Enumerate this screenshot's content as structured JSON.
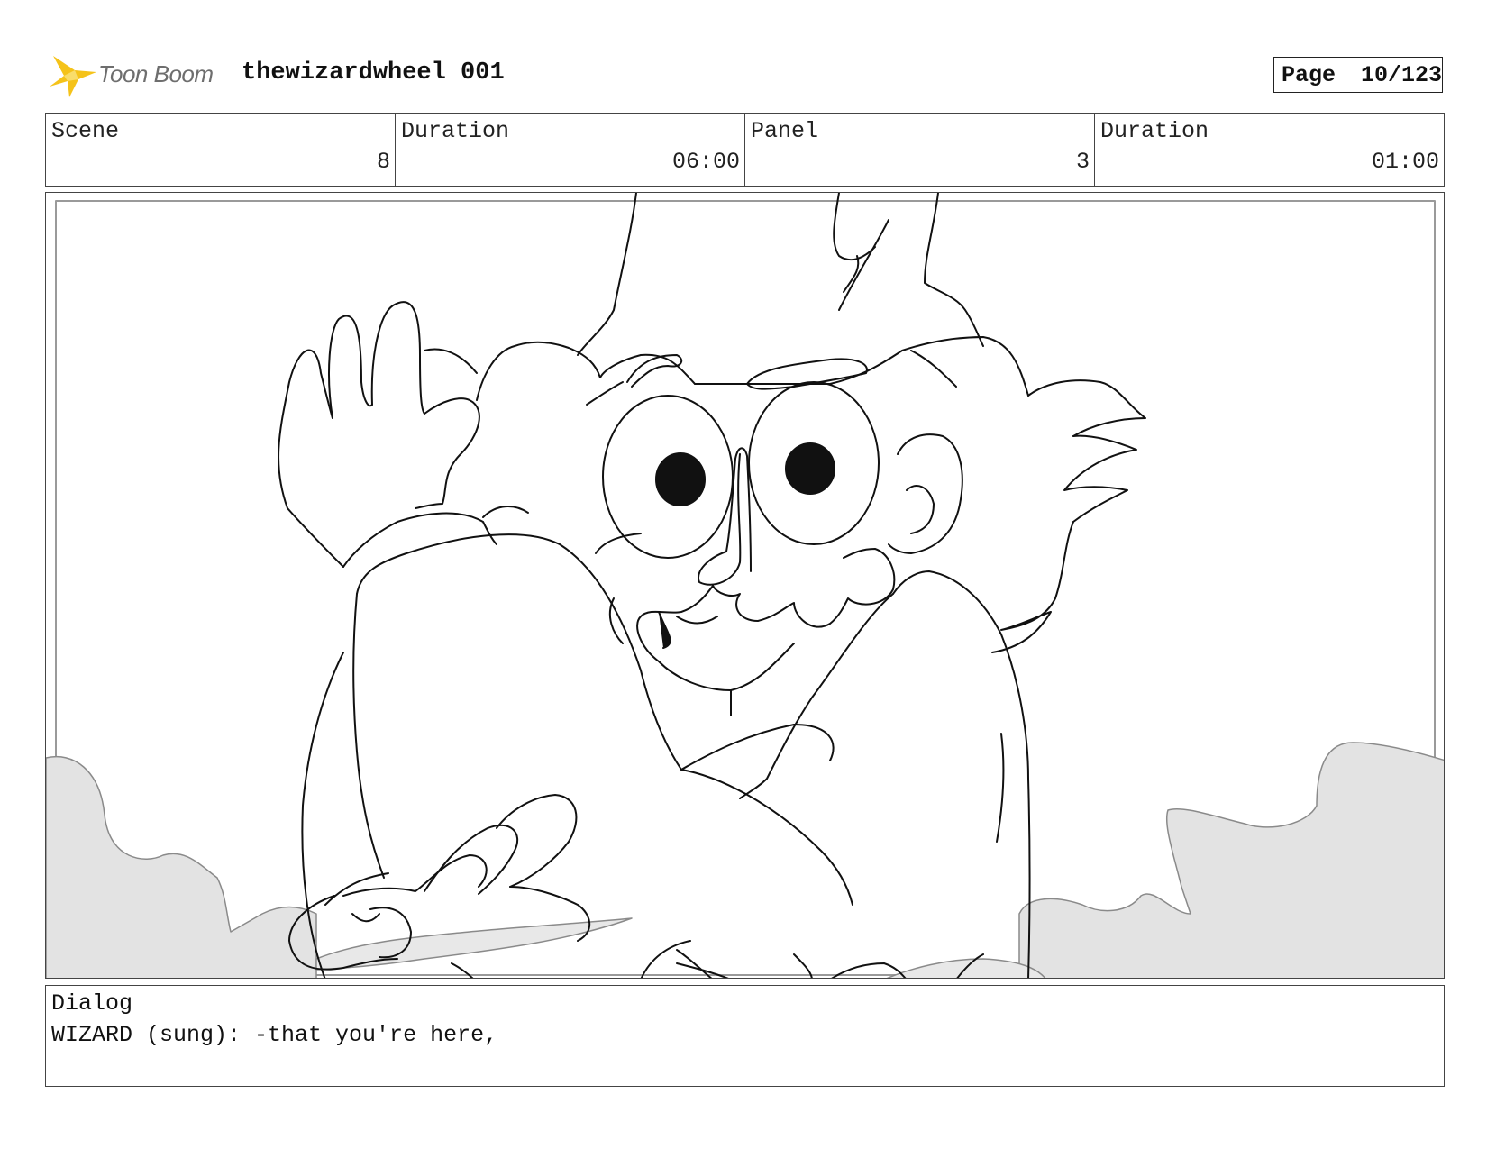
{
  "header": {
    "logo_text": "Toon Boom",
    "project_title": "thewizardwheel 001",
    "page_label": "Page",
    "page_value": "10/123"
  },
  "info": {
    "scene_label": "Scene",
    "scene_value": "8",
    "scene_duration_label": "Duration",
    "scene_duration_value": "06:00",
    "panel_label": "Panel",
    "panel_value": "3",
    "panel_duration_label": "Duration",
    "panel_duration_value": "01:00"
  },
  "dialog": {
    "label": "Dialog",
    "text": "WIZARD (sung): -that you're here,"
  },
  "colors": {
    "logo_star": "#f5c31a",
    "cloud_fill": "#e3e3e3",
    "line": "#111111"
  }
}
